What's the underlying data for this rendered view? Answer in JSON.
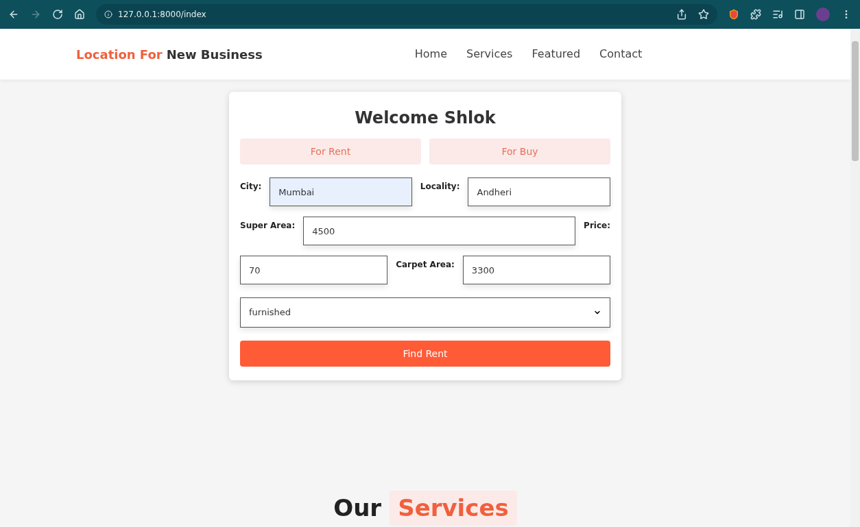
{
  "browser": {
    "url": "127.0.0.1:8000/index"
  },
  "navbar": {
    "brand_accent": "Location For",
    "brand_rest": "New Business",
    "links": [
      "Home",
      "Services",
      "Featured",
      "Contact"
    ]
  },
  "form": {
    "title": "Welcome Shlok",
    "mode_buttons": [
      "For Rent",
      "For Buy"
    ],
    "location_line": [
      {
        "kind": "label",
        "text": "City:"
      },
      {
        "kind": "input",
        "value": "Mumbai",
        "autofilled": true
      },
      {
        "kind": "label",
        "text": "Locality:"
      },
      {
        "kind": "input",
        "value": "Andheri",
        "autofilled": false
      }
    ],
    "super_area_line": [
      {
        "kind": "label",
        "text": "Super Area:"
      },
      {
        "kind": "input",
        "value": "4500",
        "autofilled": false
      },
      {
        "kind": "label",
        "text": "Price:"
      }
    ],
    "price_line": [
      {
        "kind": "input",
        "value": "70",
        "autofilled": false
      },
      {
        "kind": "label",
        "text": "Carpet Area:"
      },
      {
        "kind": "input",
        "value": "3300",
        "autofilled": false
      }
    ],
    "select": {
      "value": "furnished"
    },
    "submit": "Find Rent"
  },
  "services_heading": {
    "plain": "Our",
    "accent": "Services"
  }
}
